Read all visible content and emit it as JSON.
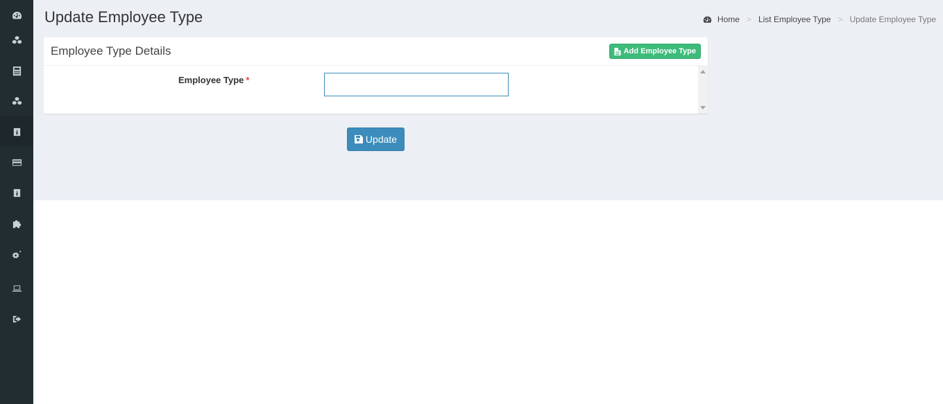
{
  "sidebar": {
    "items": [
      {
        "icon": "dashboard-icon"
      },
      {
        "icon": "cubes-icon"
      },
      {
        "icon": "calculator-icon"
      },
      {
        "icon": "cubes-icon"
      },
      {
        "icon": "id-badge-icon"
      },
      {
        "icon": "credit-card-icon"
      },
      {
        "icon": "id-badge-icon"
      },
      {
        "icon": "puzzle-icon"
      },
      {
        "icon": "gears-icon"
      },
      {
        "icon": "laptop-icon"
      },
      {
        "icon": "sign-out-icon"
      }
    ]
  },
  "header": {
    "title": "Update Employee Type"
  },
  "breadcrumb": {
    "home": "Home",
    "list": "List Employee Type",
    "current": "Update Employee Type",
    "separator": ">"
  },
  "box": {
    "title": "Employee Type Details",
    "add_button_label": "Add Employee Type"
  },
  "form": {
    "employee_type_label": "Employee Type",
    "required_marker": "*",
    "employee_type_value": ""
  },
  "actions": {
    "update_label": "Update"
  },
  "colors": {
    "sidebar_bg": "#222d32",
    "content_bg": "#ecf0f5",
    "primary": "#3c8dbc",
    "success": "#3dbb7a",
    "required": "#dd4b39"
  }
}
